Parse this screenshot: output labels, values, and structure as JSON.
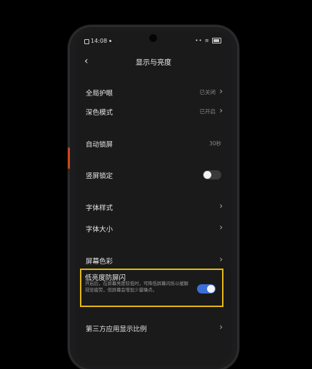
{
  "status": {
    "time": "14:08",
    "icons": "•• ≡"
  },
  "header": {
    "title": "显示与亮度"
  },
  "rows": {
    "eye_care": {
      "label": "全局护眼",
      "value": "已关闭"
    },
    "dark_mode": {
      "label": "深色模式",
      "value": "已开启"
    },
    "auto_lock": {
      "label": "自动锁屏",
      "value": "30秒"
    },
    "portrait_lock": {
      "label": "竖屏锁定",
      "toggle": false
    },
    "font_style": {
      "label": "字体样式"
    },
    "font_size": {
      "label": "字体大小"
    },
    "screen_color": {
      "label": "屏幕色彩"
    },
    "dc_dimming": {
      "label": "低亮度防屏闪",
      "description": "开启后，在屏幕亮度较低时，可降低屏幕闪烁以缓解视觉疲劳，但屏幕会增加少量噪点。",
      "toggle": true
    },
    "third_party": {
      "label": "第三方应用显示比例"
    }
  },
  "colors": {
    "highlight": "#e6b815",
    "toggle_on": "#3b6fd8"
  }
}
